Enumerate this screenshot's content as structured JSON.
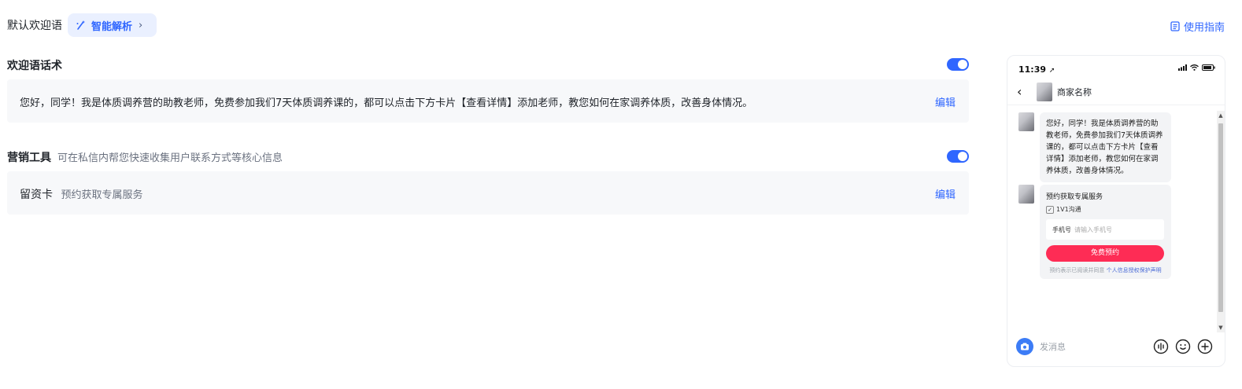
{
  "header": {
    "title": "默认欢迎语",
    "ai_button": "智能解析",
    "guide_link": "使用指南"
  },
  "welcome": {
    "title": "欢迎语话术",
    "enabled": true,
    "text": "您好，同学！我是体质调养营的助教老师，免费参加我们7天体质调养课的，都可以点击下方卡片【查看详情】添加老师，教您如何在家调养体质，改善身体情况。",
    "edit_label": "编辑"
  },
  "marketing": {
    "title": "营销工具",
    "desc": "可在私信内帮您快速收集用户联系方式等核心信息",
    "enabled": true,
    "card_name": "留资卡",
    "card_desc": "预约获取专属服务",
    "edit_label": "编辑"
  },
  "preview": {
    "time": "11:39",
    "merchant_name": "商家名称",
    "message": "您好，同学！我是体质调养营的助教老师，免费参加我们7天体质调养课的，都可以点击下方卡片【查看详情】添加老师，教您如何在家调养体质，改善身体情况。",
    "card": {
      "title": "预约获取专属服务",
      "option": "1V1沟通",
      "phone_label": "手机号",
      "phone_placeholder": "请输入手机号",
      "button": "免费预约",
      "note": "预约表示已阅读并同意",
      "note_link": "个人信息授权保护声明"
    },
    "input_placeholder": "发消息"
  },
  "colors": {
    "accent": "#2f66ff",
    "toggle_on": "#2f66ff",
    "cta": "#fe2c55"
  }
}
